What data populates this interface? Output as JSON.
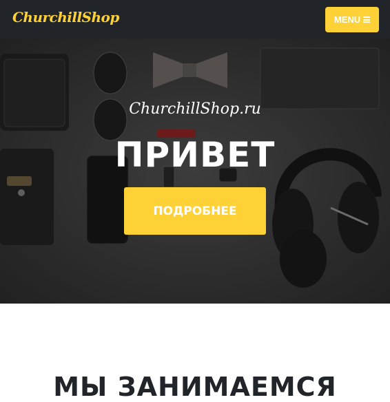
{
  "navbar": {
    "brand": "ChurchillShop",
    "menu_label": "MENU",
    "menu_icon": "hamburger-icon"
  },
  "hero": {
    "subheading": "ChurchillShop.ru",
    "heading": "ПРИВЕТ",
    "cta_label": "ПОДРОБНЕЕ",
    "background": "flat-lay-accessories-photo"
  },
  "services": {
    "title": "МЫ ЗАНИМАЕМСЯ"
  },
  "colors": {
    "accent": "#fed136",
    "navbar_bg": "#212529",
    "text_dark": "#212529"
  }
}
